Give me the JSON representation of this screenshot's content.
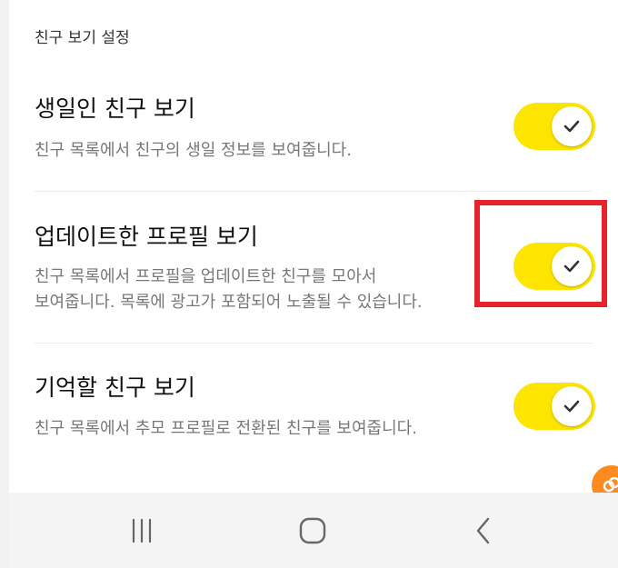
{
  "section": {
    "header": "친구 보기 설정"
  },
  "settings": [
    {
      "title": "생일인 친구 보기",
      "description": "친구 목록에서 친구의 생일 정보를 보여줍니다.",
      "description_line2": "",
      "enabled": true
    },
    {
      "title": "업데이트한 프로필 보기",
      "description": "친구 목록에서 프로필을 업데이트한 친구를 모아서",
      "description_line2": "보여줍니다. 목록에 광고가 포함되어 노출될 수 있습니다.",
      "enabled": true
    },
    {
      "title": "기억할 친구 보기",
      "description": "친구 목록에서 추모 프로필로 전환된 친구를 보여줍니다.",
      "description_line2": "",
      "enabled": true
    }
  ],
  "colors": {
    "toggle_on": "#FEE500",
    "highlight": "#E8222A",
    "fab": "#FF8A1F",
    "nav_bar_bg": "#F4F4F4"
  },
  "icons": {
    "toggle_knob": "check-icon",
    "fab": "link-icon",
    "nav_recent": "recent-apps-icon",
    "nav_home": "home-icon",
    "nav_back": "back-icon"
  }
}
